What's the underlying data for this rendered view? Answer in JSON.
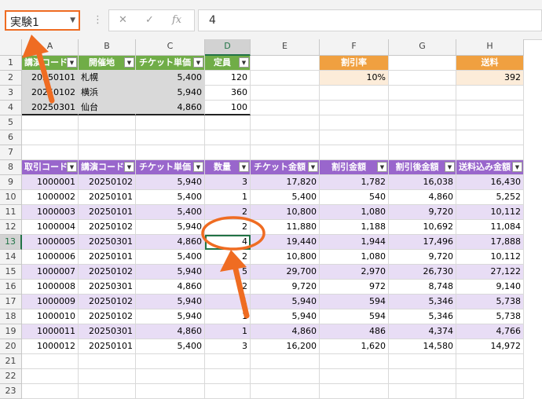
{
  "name_box": {
    "value": "実験1"
  },
  "formula_bar": {
    "value": "4",
    "cancel_icon": "✕",
    "enter_icon": "✓",
    "fx": "fx",
    "more_icon": "⋮"
  },
  "columns": [
    "A",
    "B",
    "C",
    "D",
    "E",
    "F",
    "G",
    "H"
  ],
  "selected": {
    "col": "D",
    "row": "13"
  },
  "rows": [
    "1",
    "2",
    "3",
    "4",
    "5",
    "6",
    "7",
    "8",
    "9",
    "10",
    "11",
    "12",
    "13",
    "14",
    "15",
    "16",
    "17",
    "18",
    "19",
    "20",
    "21",
    "22",
    "23"
  ],
  "table1": {
    "headers": [
      "講演コード",
      "開催地",
      "チケット単価",
      "定員"
    ],
    "rows": [
      [
        "20250101",
        "札幌",
        "5,400",
        "120"
      ],
      [
        "20250102",
        "横浜",
        "5,940",
        "360"
      ],
      [
        "20250301",
        "仙台",
        "4,860",
        "100"
      ]
    ]
  },
  "discount": {
    "header": "割引率",
    "value": "10%"
  },
  "shipping": {
    "header": "送料",
    "value": "392"
  },
  "table2": {
    "headers": [
      "取引コード",
      "講演コード",
      "チケット単価",
      "数量",
      "チケット金額",
      "割引金額",
      "割引後金額",
      "送料込み金額"
    ],
    "rows": [
      [
        "1000001",
        "20250102",
        "5,940",
        "3",
        "17,820",
        "1,782",
        "16,038",
        "16,430"
      ],
      [
        "1000002",
        "20250101",
        "5,400",
        "1",
        "5,400",
        "540",
        "4,860",
        "5,252"
      ],
      [
        "1000003",
        "20250101",
        "5,400",
        "2",
        "10,800",
        "1,080",
        "9,720",
        "10,112"
      ],
      [
        "1000004",
        "20250102",
        "5,940",
        "2",
        "11,880",
        "1,188",
        "10,692",
        "11,084"
      ],
      [
        "1000005",
        "20250301",
        "4,860",
        "4",
        "19,440",
        "1,944",
        "17,496",
        "17,888"
      ],
      [
        "1000006",
        "20250101",
        "5,400",
        "2",
        "10,800",
        "1,080",
        "9,720",
        "10,112"
      ],
      [
        "1000007",
        "20250102",
        "5,940",
        "5",
        "29,700",
        "2,970",
        "26,730",
        "27,122"
      ],
      [
        "1000008",
        "20250301",
        "4,860",
        "2",
        "9,720",
        "972",
        "8,748",
        "9,140"
      ],
      [
        "1000009",
        "20250102",
        "5,940",
        "1",
        "5,940",
        "594",
        "5,346",
        "5,738"
      ],
      [
        "1000010",
        "20250102",
        "5,940",
        "1",
        "5,940",
        "594",
        "5,346",
        "5,738"
      ],
      [
        "1000011",
        "20250301",
        "4,860",
        "1",
        "4,860",
        "486",
        "4,374",
        "4,766"
      ],
      [
        "1000012",
        "20250101",
        "5,400",
        "3",
        "16,200",
        "1,620",
        "14,580",
        "14,972"
      ]
    ]
  },
  "colors": {
    "accent": "#ef6c22",
    "green": "#70ad47",
    "purple": "#9966cc",
    "orange": "#f0a040",
    "excel_green": "#217346"
  }
}
